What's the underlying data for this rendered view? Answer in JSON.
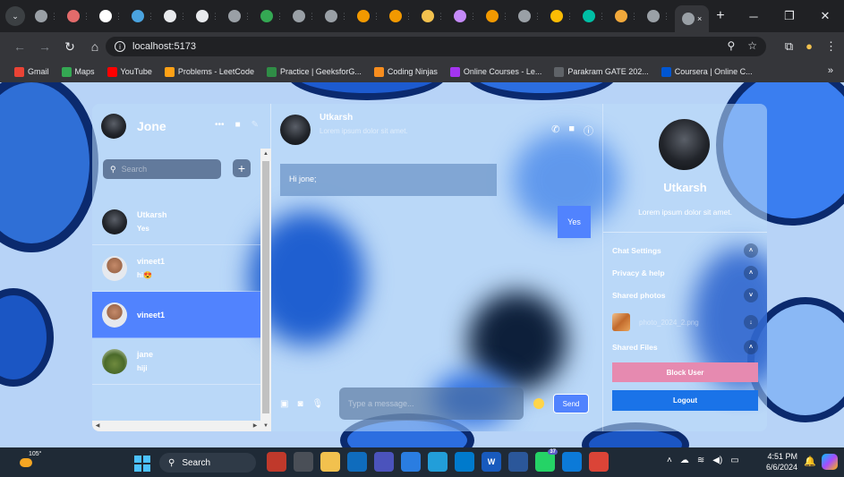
{
  "browser": {
    "address": "localhost:5173",
    "tabs": [
      {
        "label": "",
        "color": "#9aa0a6"
      },
      {
        "label": "",
        "color": "#e36b6b"
      },
      {
        "label": "",
        "color": "#ffffff"
      },
      {
        "label": "",
        "color": "#4aa3df"
      },
      {
        "label": "",
        "color": "#e8eaed"
      },
      {
        "label": "",
        "color": "#e8eaed"
      },
      {
        "label": "",
        "color": "#9aa0a6"
      },
      {
        "label": "",
        "color": "#34a853"
      },
      {
        "label": "",
        "color": "#9aa0a6"
      },
      {
        "label": "",
        "color": "#9aa0a6"
      },
      {
        "label": "",
        "color": "#f29900"
      },
      {
        "label": "",
        "color": "#f29900"
      },
      {
        "label": "",
        "color": "#f2c14e"
      },
      {
        "label": "",
        "color": "#c58af9"
      },
      {
        "label": "",
        "color": "#f29900"
      },
      {
        "label": "",
        "color": "#9aa0a6"
      },
      {
        "label": "",
        "color": "#fbbc04"
      },
      {
        "label": "",
        "color": "#00bfa5"
      },
      {
        "label": "",
        "color": "#f2a93b"
      },
      {
        "label": "",
        "color": "#9aa0a6"
      }
    ],
    "active_tab_close": "×",
    "new_tab": "+",
    "bookmarks": [
      {
        "label": "Gmail",
        "color": "#ea4335"
      },
      {
        "label": "Maps",
        "color": "#34a853"
      },
      {
        "label": "YouTube",
        "color": "#ff0000"
      },
      {
        "label": "Problems - LeetCode",
        "color": "#ffa116"
      },
      {
        "label": "Practice | GeeksforG...",
        "color": "#2f8d46"
      },
      {
        "label": "Coding Ninjas",
        "color": "#f78d1e"
      },
      {
        "label": "Online Courses - Le...",
        "color": "#a435f0"
      },
      {
        "label": "Parakram GATE 202...",
        "color": "#5f6368"
      },
      {
        "label": "Coursera | Online C...",
        "color": "#0056d2"
      }
    ],
    "bookmarks_more": "»"
  },
  "app": {
    "current_user": {
      "name": "Jone"
    },
    "search": {
      "placeholder": "Search"
    },
    "add_label": "+",
    "chats": [
      {
        "name": "Utkarsh",
        "last": "Yes",
        "avatar": "dark",
        "selected": false
      },
      {
        "name": "vineet1",
        "last": "hi😍",
        "avatar": "face",
        "selected": false
      },
      {
        "name": "vineet1",
        "last": "",
        "avatar": "face",
        "selected": true
      },
      {
        "name": "jane",
        "last": "hiji",
        "avatar": "green",
        "selected": false
      }
    ],
    "chat": {
      "contact_name": "Utkarsh",
      "contact_status": "Lorem ipsum dolor sit amet.",
      "messages": [
        {
          "text": "Hi jone;",
          "own": false
        },
        {
          "text": "Yes",
          "own": true
        }
      ],
      "input_placeholder": "Type a message...",
      "send_label": "Send"
    },
    "detail": {
      "name": "Utkarsh",
      "description": "Lorem ipsum dolor sit amet.",
      "options": [
        {
          "label": "Chat Settings",
          "chevron": "˄"
        },
        {
          "label": "Privacy & help",
          "chevron": "˄"
        },
        {
          "label": "Shared photos",
          "chevron": "˅"
        },
        {
          "label": "Shared Files",
          "chevron": "˄"
        }
      ],
      "shared_photo": {
        "name": "photo_2024_2.png"
      },
      "block_label": "Block User",
      "logout_label": "Logout"
    },
    "colors": {
      "accent": "#5183fe",
      "block": "#e68ab0",
      "logout": "#1a73e8"
    }
  },
  "taskbar": {
    "temperature": "105°",
    "search_label": "Search",
    "apps": [
      {
        "label": "",
        "color": "#c0392b"
      },
      {
        "label": "",
        "color": "#4a4f57"
      },
      {
        "label": "",
        "color": "#f2c14e"
      },
      {
        "label": "",
        "color": "#0f6cbd"
      },
      {
        "label": "",
        "color": "#4b53bc"
      },
      {
        "label": "",
        "color": "#2a7de1"
      },
      {
        "label": "",
        "color": "#229ed9"
      },
      {
        "label": "",
        "color": "#007acc"
      },
      {
        "label": "W",
        "color": "#185abd"
      },
      {
        "label": "",
        "color": "#2b579a"
      },
      {
        "label": "",
        "color": "#25d366",
        "badge": "37"
      },
      {
        "label": "",
        "color": "#0c7ad8"
      },
      {
        "label": "",
        "color": "#db4437"
      }
    ],
    "time": "4:51 PM",
    "date": "6/6/2024"
  }
}
